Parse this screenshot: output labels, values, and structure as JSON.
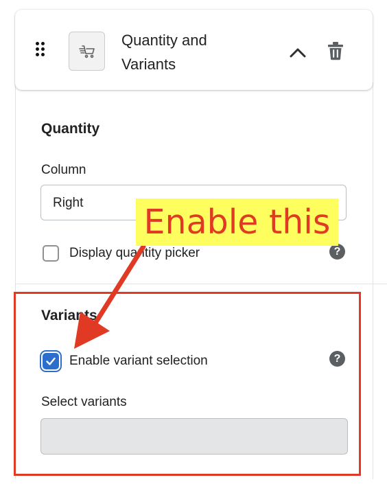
{
  "header": {
    "title_line1": "Quantity and",
    "title_line2": "Variants",
    "drag_icon": "drag-handle-icon",
    "block_icon": "cart-fast-icon",
    "collapse_icon": "chevron-up-icon",
    "delete_icon": "trash-icon"
  },
  "quantity": {
    "heading": "Quantity",
    "column_label": "Column",
    "column_value": "Right",
    "display_picker_label": "Display quantity picker",
    "display_picker_checked": false,
    "help_glyph": "?"
  },
  "variants": {
    "heading": "Variants",
    "enable_label": "Enable variant selection",
    "enable_checked": true,
    "help_glyph": "?",
    "select_label": "Select variants",
    "select_value": ""
  },
  "annotation": {
    "callout_text": "Enable this",
    "accent_color": "#e03a24",
    "callout_bg": "#fefe5e"
  },
  "colors": {
    "checkbox_blue": "#2c6ecb",
    "text": "#202223",
    "border": "#babfc3"
  }
}
